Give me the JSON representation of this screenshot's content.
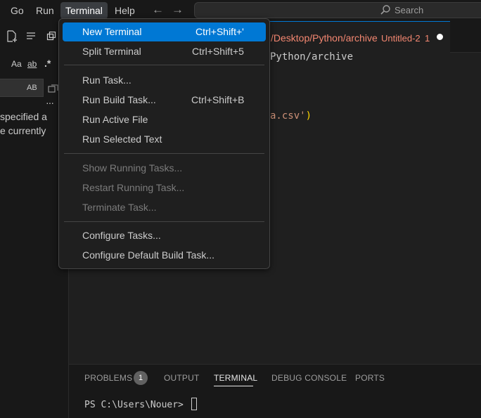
{
  "menubar": {
    "go": "Go",
    "run": "Run",
    "terminal": "Terminal",
    "help": "Help",
    "back_icon": "arrow-left-icon",
    "forward_icon": "arrow-right-icon",
    "search_placeholder": "Search"
  },
  "left_panel": {
    "match_case": "Aa",
    "match_word": "ab",
    "regex": ".*",
    "replace_preserve_case": "AB",
    "more": "···",
    "message_line1": "specified a",
    "message_line2": "e currently"
  },
  "editor": {
    "tab_path": "/Desktop/Python/archive",
    "tab_name": "Untitled-2",
    "tab_problem_count": "1",
    "breadcrumb": "Python/archive",
    "code_text": "a.csv'",
    "code_paren": ")"
  },
  "terminal_menu": {
    "items": [
      {
        "label": "New Terminal",
        "shortcut": "Ctrl+Shift+'",
        "highlighted": true
      },
      {
        "label": "Split Terminal",
        "shortcut": "Ctrl+Shift+5"
      },
      {
        "label": "Run Task..."
      },
      {
        "label": "Run Build Task...",
        "shortcut": "Ctrl+Shift+B"
      },
      {
        "label": "Run Active File"
      },
      {
        "label": "Run Selected Text"
      },
      {
        "label": "Show Running Tasks...",
        "disabled": true
      },
      {
        "label": "Restart Running Task...",
        "disabled": true
      },
      {
        "label": "Terminate Task...",
        "disabled": true
      },
      {
        "label": "Configure Tasks..."
      },
      {
        "label": "Configure Default Build Task..."
      }
    ]
  },
  "panel": {
    "tabs": [
      "PROBLEMS",
      "OUTPUT",
      "TERMINAL",
      "DEBUG CONSOLE",
      "PORTS"
    ],
    "active_tab": "TERMINAL",
    "problems_count": "1",
    "terminal_prompt": "PS C:\\Users\\Nouer>"
  },
  "colors": {
    "accent": "#0078d4",
    "error": "#f48771",
    "string": "#ce9178",
    "bracket": "#ffd700"
  }
}
